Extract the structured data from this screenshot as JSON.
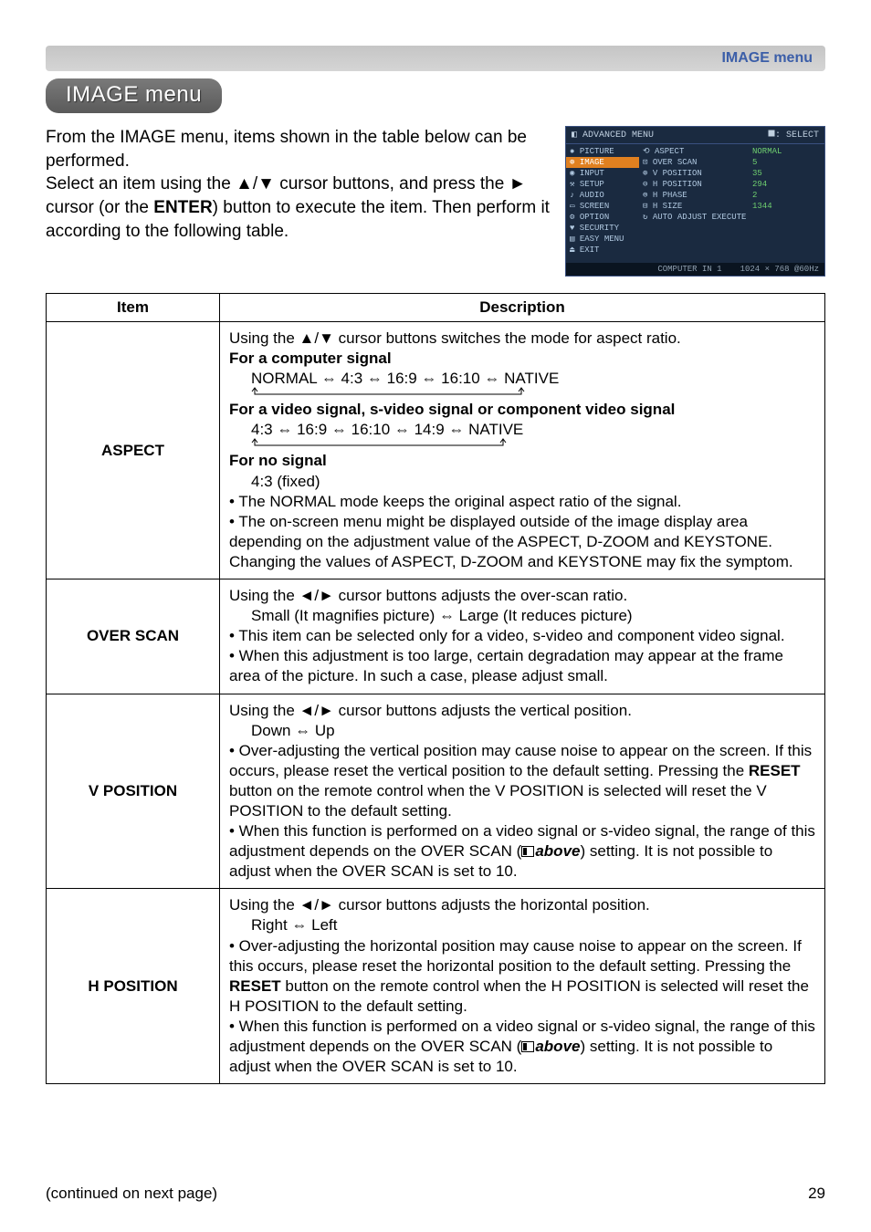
{
  "topbar": {
    "label": "IMAGE menu"
  },
  "pill": {
    "title": "IMAGE menu"
  },
  "intro": {
    "p1": "From the IMAGE menu, items shown in the table below can be performed.",
    "p2_a": "Select an item using the ▲/▼ cursor buttons, and press the ► cursor (or the ",
    "p2_enter": "ENTER",
    "p2_b": ") button to execute the item. Then perform it according to the following table."
  },
  "osd": {
    "header_left": "◧ ADVANCED MENU",
    "header_right": "⯀: SELECT",
    "left": [
      {
        "label": "✹ PICTURE",
        "hl": false
      },
      {
        "label": "⊕ IMAGE",
        "hl": true
      },
      {
        "label": "◉ INPUT",
        "hl": false
      },
      {
        "label": "⚒ SETUP",
        "hl": false
      },
      {
        "label": "♪ AUDIO",
        "hl": false
      },
      {
        "label": "▭ SCREEN",
        "hl": false
      },
      {
        "label": "⚙ OPTION",
        "hl": false
      },
      {
        "label": "♥ SECURITY",
        "hl": false
      },
      {
        "label": "▤ EASY MENU",
        "hl": false
      },
      {
        "label": "⏏ EXIT",
        "hl": false
      }
    ],
    "middle": [
      "⟲ ASPECT",
      "⊡ OVER SCAN",
      "⊕ V POSITION",
      "⊖ H POSITION",
      "⊜ H PHASE",
      "⊟ H SIZE",
      "↻ AUTO ADJUST EXECUTE"
    ],
    "right": [
      "NORMAL",
      "5",
      "35",
      "294",
      "2",
      "1344",
      ""
    ],
    "footer_left": "COMPUTER IN 1",
    "footer_right": "1024 × 768 @60Hz"
  },
  "table": {
    "h_item": "Item",
    "h_desc": "Description",
    "rows": [
      {
        "item": "ASPECT",
        "lines": {
          "l1": "Using the ▲/▼ cursor buttons switches the mode for aspect ratio.",
          "l2": "For a computer signal",
          "l3": "NORMAL ⇔ 4:3 ⇔ 16:9 ⇔ 16:10 ⇔ NATIVE",
          "l4": "For a video signal, s-video signal or component video signal",
          "l5": "4:3 ⇔ 16:9 ⇔ 16:10 ⇔ 14:9 ⇔ NATIVE",
          "l6": "For no signal",
          "l7": "4:3 (fixed)",
          "l8": "• The NORMAL mode keeps the original aspect ratio of the signal.",
          "l9": "• The on-screen menu might be displayed outside of the image display area depending on the adjustment value of the ASPECT, D-ZOOM and KEYSTONE. Changing the values of ASPECT, D-ZOOM and KEYSTONE may fix the symptom."
        }
      },
      {
        "item": "OVER SCAN",
        "lines": {
          "l1": "Using the ◄/► cursor buttons adjusts the over-scan ratio.",
          "l2": "Small (It magnifies picture) ⇔ Large (It reduces picture)",
          "l3": "• This item can be selected only for a video, s-video and component video signal.",
          "l4": "• When this adjustment is too large, certain degradation may appear at the frame area of the picture. In such a case, please adjust small."
        }
      },
      {
        "item": "V POSITION",
        "lines": {
          "l1": "Using the ◄/► cursor buttons adjusts the vertical position.",
          "l2": "Down ⇔ Up",
          "l3a": "• Over-adjusting the vertical position may cause noise to appear on the screen. If this occurs, please reset the vertical position to the default setting. Pressing the ",
          "l3_reset": "RESET",
          "l3b": " button on the remote control when the V POSITION is selected will reset the V POSITION to the default setting.",
          "l4a": "• When this function is performed on a video signal or s-video signal, the range of this adjustment depends on the OVER SCAN (",
          "l4_ref": "above",
          "l4b": ") setting. It is not possible to adjust when the OVER SCAN is set to 10."
        }
      },
      {
        "item": "H POSITION",
        "lines": {
          "l1": "Using the ◄/► cursor buttons adjusts the horizontal position.",
          "l2": "Right ⇔ Left",
          "l3a": "• Over-adjusting the horizontal position may cause noise to appear on the screen. If this occurs, please reset the horizontal position to the default setting. Pressing the ",
          "l3_reset": "RESET",
          "l3b": " button on the remote control when the H POSITION is selected will reset the H POSITION to the default setting.",
          "l4a": "• When this function is performed on a video signal or s-video signal, the range of this adjustment depends on the OVER SCAN (",
          "l4_ref": "above",
          "l4b": ") setting. It is not possible to adjust when the OVER SCAN is set to 10."
        }
      }
    ]
  },
  "footer": {
    "continued": "(continued on next page)",
    "page": "29"
  }
}
